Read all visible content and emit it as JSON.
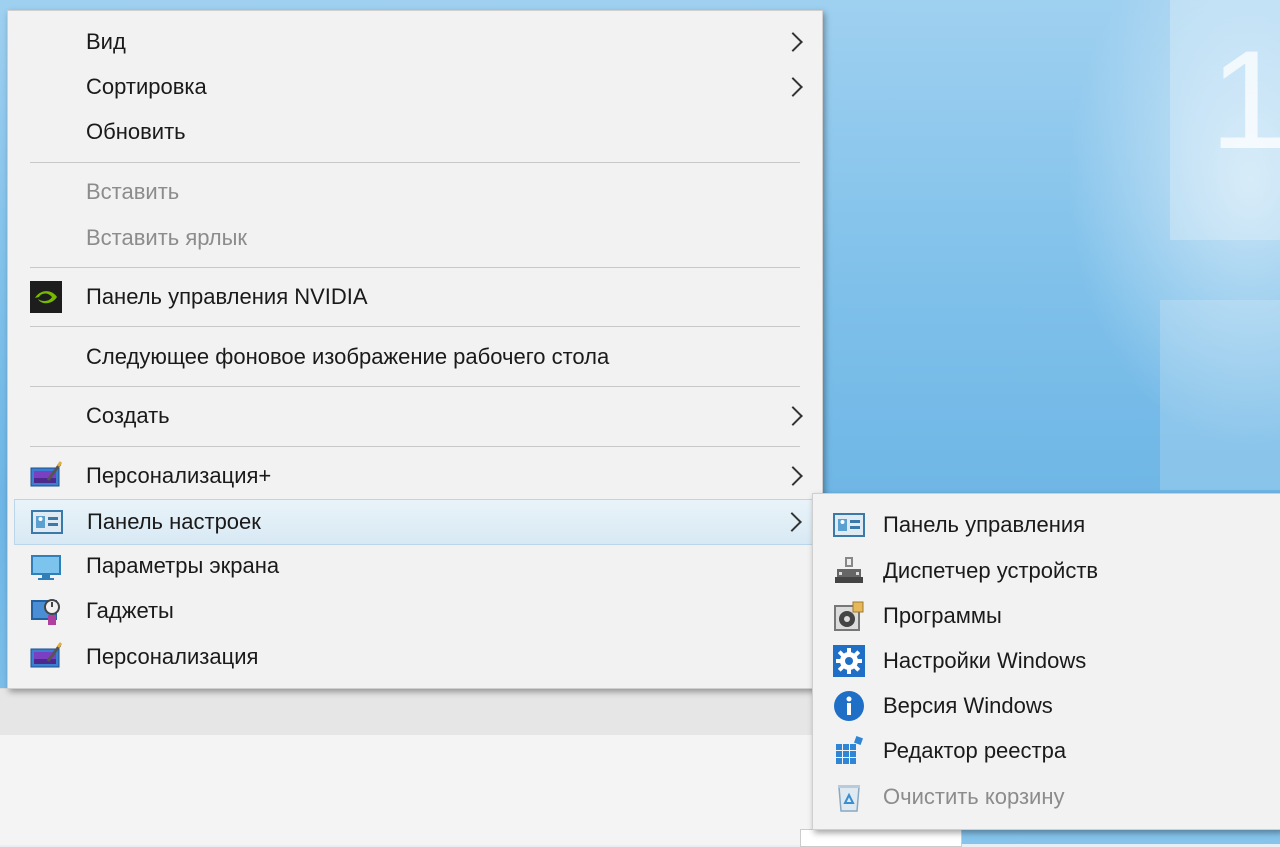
{
  "main_menu": {
    "items": [
      {
        "label": "Вид",
        "submenu": true,
        "disabled": false,
        "icon": null
      },
      {
        "label": "Сортировка",
        "submenu": true,
        "disabled": false,
        "icon": null
      },
      {
        "label": "Обновить",
        "submenu": false,
        "disabled": false,
        "icon": null
      },
      {
        "label": "Вставить",
        "submenu": false,
        "disabled": true,
        "icon": null
      },
      {
        "label": "Вставить ярлык",
        "submenu": false,
        "disabled": true,
        "icon": null
      },
      {
        "label": "Панель управления NVIDIA",
        "submenu": false,
        "disabled": false,
        "icon": "nvidia-icon"
      },
      {
        "label": "Следующее фоновое изображение рабочего стола",
        "submenu": false,
        "disabled": false,
        "icon": null
      },
      {
        "label": "Создать",
        "submenu": true,
        "disabled": false,
        "icon": null
      },
      {
        "label": "Персонализация+",
        "submenu": true,
        "disabled": false,
        "icon": "personalization-icon"
      },
      {
        "label": "Панель настроек",
        "submenu": true,
        "disabled": false,
        "icon": "control-panel-icon",
        "highlighted": true
      },
      {
        "label": "Параметры экрана",
        "submenu": false,
        "disabled": false,
        "icon": "display-icon"
      },
      {
        "label": "Гаджеты",
        "submenu": false,
        "disabled": false,
        "icon": "gadgets-icon"
      },
      {
        "label": "Персонализация",
        "submenu": false,
        "disabled": false,
        "icon": "personalization-icon"
      }
    ]
  },
  "sub_menu": {
    "items": [
      {
        "label": "Панель управления",
        "disabled": false,
        "icon": "control-panel-icon"
      },
      {
        "label": "Диспетчер устройств",
        "disabled": false,
        "icon": "device-manager-icon"
      },
      {
        "label": "Программы",
        "disabled": false,
        "icon": "programs-icon"
      },
      {
        "label": "Настройки Windows",
        "disabled": false,
        "icon": "gear-icon"
      },
      {
        "label": "Версия Windows",
        "disabled": false,
        "icon": "info-icon"
      },
      {
        "label": "Редактор реестра",
        "disabled": false,
        "icon": "registry-editor-icon"
      },
      {
        "label": "Очистить корзину",
        "disabled": true,
        "icon": "recycle-bin-icon"
      }
    ]
  },
  "desktop": {
    "tile_glyph": "1"
  },
  "colors": {
    "menu_bg": "#f2f2f2",
    "highlight": "#d8e9f4",
    "disabled_text": "#8c8c8c",
    "desktop_blue": "#7ec0ea"
  }
}
